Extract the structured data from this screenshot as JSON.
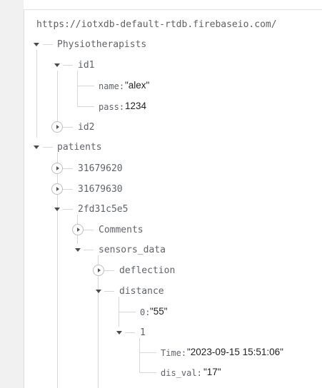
{
  "db": {
    "url": "https://iotxdb-default-rtdb.firebaseio.com/"
  },
  "tree": {
    "physiotherapists": "Physiotherapists",
    "id1": "id1",
    "name_key": "name:",
    "name_val": "\"alex\"",
    "pass_key": "pass:",
    "pass_val": "1234",
    "id2": "id2",
    "patients": "patients",
    "p1": "31679620",
    "p2": "31679630",
    "p3": "2fd31c5e5",
    "comments": "Comments",
    "sensors_data": "sensors_data",
    "deflection": "deflection",
    "distance": "distance",
    "d0_key": "0:",
    "d0_val": "\"55\"",
    "d1": "1",
    "time_key": "Time:",
    "time_val": "\"2023-09-15 15:51:06\"",
    "disval_key": "dis_val:",
    "disval_val": "\"17\""
  }
}
